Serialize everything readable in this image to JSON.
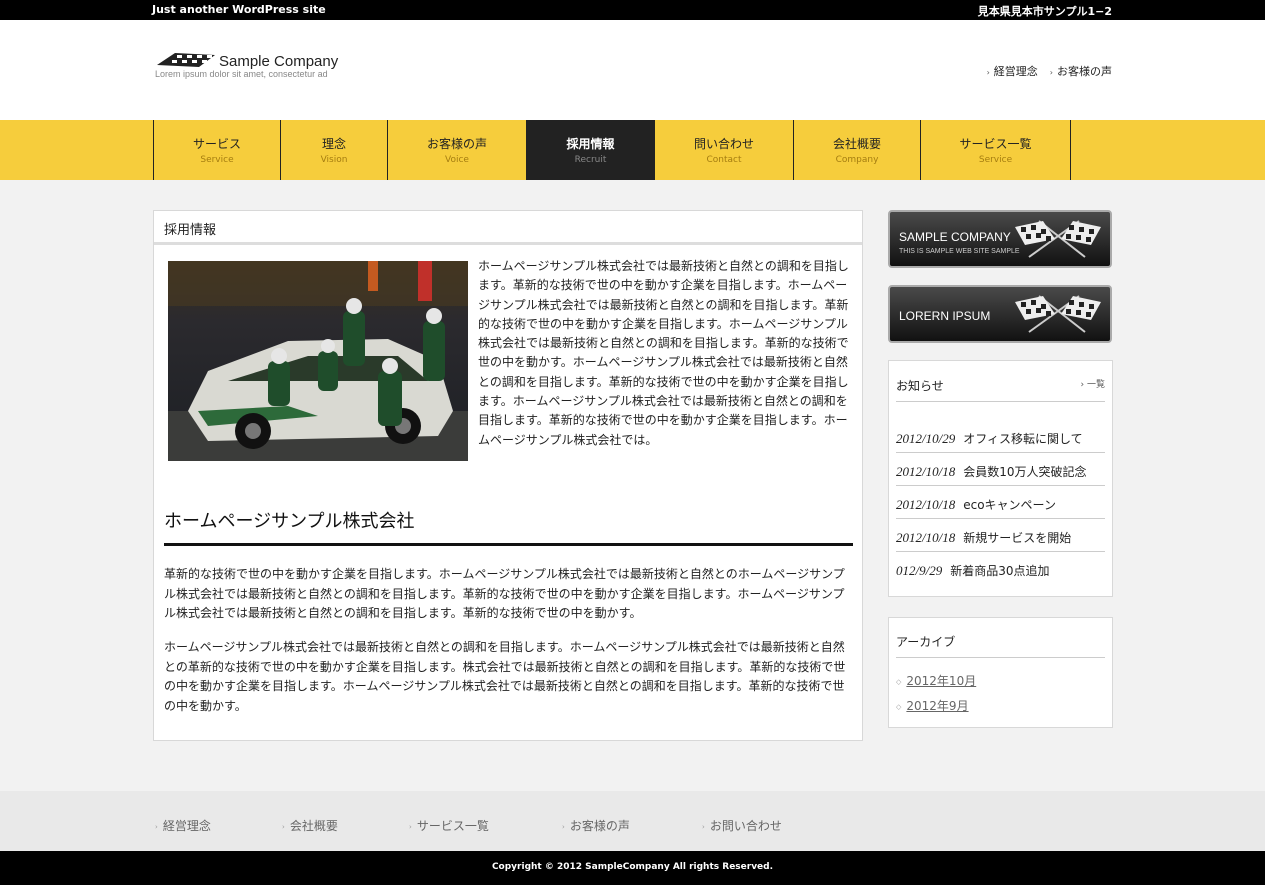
{
  "topbar": {
    "tagline": "Just another WordPress site",
    "address": "見本県見本市サンプル1−2"
  },
  "header": {
    "logo_name": "Sample Company",
    "logo_sub": "Lorem ipsum dolor sit amet, consectetur ad",
    "links": [
      "経営理念",
      "お客様の声"
    ]
  },
  "nav": [
    {
      "jp": "サービス",
      "en": "Service"
    },
    {
      "jp": "理念",
      "en": "Vision"
    },
    {
      "jp": "お客様の声",
      "en": "Voice"
    },
    {
      "jp": "採用情報",
      "en": "Recruit"
    },
    {
      "jp": "問い合わせ",
      "en": "Contact"
    },
    {
      "jp": "会社概要",
      "en": "Company"
    },
    {
      "jp": "サービス一覧",
      "en": "Service"
    }
  ],
  "main": {
    "title": "採用情報",
    "intro": "ホームページサンプル株式会社では最新技術と自然との調和を目指します。革新的な技術で世の中を動かす企業を目指します。ホームページサンプル株式会社では最新技術と自然との調和を目指します。革新的な技術で世の中を動かす企業を目指します。ホームページサンプル株式会社では最新技術と自然との調和を目指します。革新的な技術で世の中を動かす。ホームページサンプル株式会社では最新技術と自然との調和を目指します。革新的な技術で世の中を動かす企業を目指します。ホームページサンプル株式会社では最新技術と自然との調和を目指します。革新的な技術で世の中を動かす企業を目指します。ホームページサンプル株式会社では。",
    "section_title": "ホームページサンプル株式会社",
    "para1": "革新的な技術で世の中を動かす企業を目指します。ホームページサンプル株式会社では最新技術と自然とのホームページサンプル株式会社では最新技術と自然との調和を目指します。革新的な技術で世の中を動かす企業を目指します。ホームページサンプル株式会社では最新技術と自然との調和を目指します。革新的な技術で世の中を動かす。",
    "para2": "ホームページサンプル株式会社では最新技術と自然との調和を目指します。ホームページサンプル株式会社では最新技術と自然との革新的な技術で世の中を動かす企業を目指します。株式会社では最新技術と自然との調和を目指します。革新的な技術で世の中を動かす企業を目指します。ホームページサンプル株式会社では最新技術と自然との調和を目指します。革新的な技術で世の中を動かす。"
  },
  "sidebar": {
    "banner1_title": "SAMPLE COMPANY",
    "banner1_sub": "THIS IS SAMPLE WEB SITE SAMPLE",
    "banner2_title": "LORERN IPSUM",
    "news_title": "お知らせ",
    "news_more": "一覧",
    "news": [
      {
        "date": "2012/10/29",
        "text": "オフィス移転に関して"
      },
      {
        "date": "2012/10/18",
        "text": "会員数10万人突破記念"
      },
      {
        "date": "2012/10/18",
        "text": "ecoキャンペーン"
      },
      {
        "date": "2012/10/18",
        "text": "新規サービスを開始"
      },
      {
        "date": "012/9/29",
        "text": "新着商品30点追加"
      }
    ],
    "archive_title": "アーカイブ",
    "archives": [
      "2012年10月",
      "2012年9月"
    ]
  },
  "footer": {
    "links": [
      "経営理念",
      "会社概要",
      "サービス一覧",
      "お客様の声",
      "お問い合わせ"
    ],
    "copyright": "Copyright © 2012 SampleCompany All rights Reserved."
  },
  "icons": [
    "checkered-flag-icon",
    "arrow-icon",
    "bullet-icon"
  ],
  "colors": {
    "nav_bg": "#f6cd3c",
    "active_nav": "#222222",
    "topbar": "#000000"
  }
}
